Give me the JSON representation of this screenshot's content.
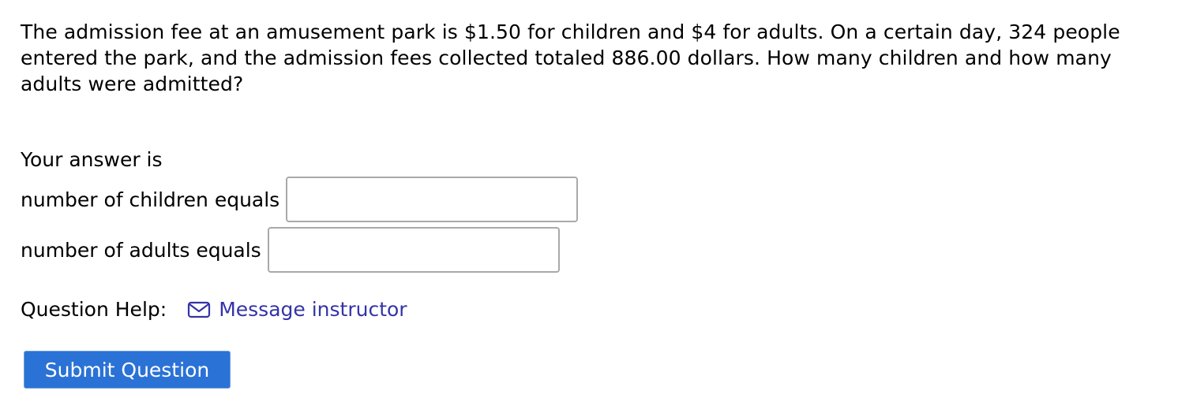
{
  "question": {
    "text": "The admission fee at an amusement park is $1.50 for children and $4 for adults. On a certain day, 324 people entered the park, and the admission fees collected totaled 886.00 dollars. How many children and how many adults were admitted?"
  },
  "answer": {
    "intro": "Your answer is",
    "children_label": "number of children equals",
    "children_value": "",
    "adults_label": "number of adults equals",
    "adults_value": ""
  },
  "help": {
    "label": "Question Help:",
    "icon": "envelope-icon",
    "link_text": "Message instructor",
    "link_color": "#3433a8"
  },
  "submit": {
    "label": "Submit Question",
    "color": "#2a72d6"
  }
}
